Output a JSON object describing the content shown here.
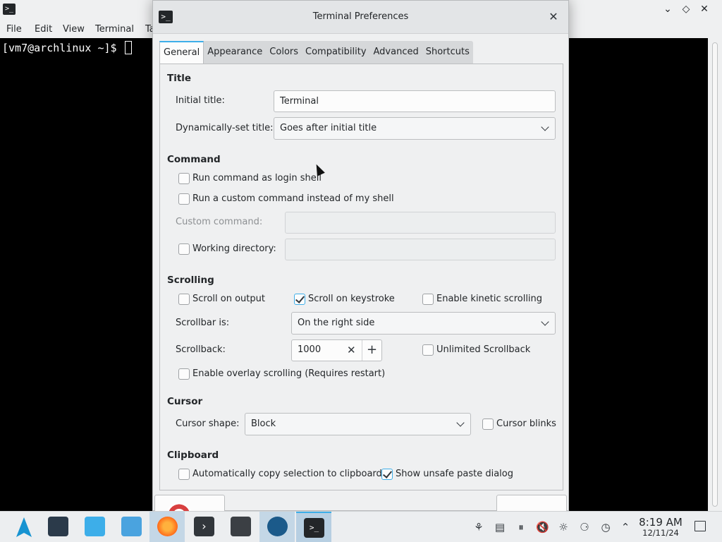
{
  "background_window": {
    "menu": [
      "File",
      "Edit",
      "View",
      "Terminal",
      "Ta"
    ],
    "prompt": "[vm7@archlinux ~]$ "
  },
  "dialog": {
    "title": "Terminal Preferences",
    "tabs": [
      "General",
      "Appearance",
      "Colors",
      "Compatibility",
      "Advanced",
      "Shortcuts"
    ],
    "active_tab": "General",
    "title_section": {
      "heading": "Title",
      "initial_title_label": "Initial title:",
      "initial_title_value": "Terminal",
      "dynamic_label": "Dynamically-set title:",
      "dynamic_value": "Goes after initial title"
    },
    "command_section": {
      "heading": "Command",
      "login_shell": "Run command as login shell",
      "login_shell_checked": false,
      "custom_command": "Run a custom command instead of my shell",
      "custom_command_checked": false,
      "custom_command_label": "Custom command:",
      "custom_command_value": "",
      "working_dir": "Working directory:",
      "working_dir_checked": false,
      "working_dir_value": ""
    },
    "scrolling_section": {
      "heading": "Scrolling",
      "scroll_output": "Scroll on output",
      "scroll_output_checked": false,
      "scroll_keystroke": "Scroll on keystroke",
      "scroll_keystroke_checked": true,
      "kinetic": "Enable kinetic scrolling",
      "kinetic_checked": false,
      "scrollbar_label": "Scrollbar is:",
      "scrollbar_value": "On the right side",
      "scrollback_label": "Scrollback:",
      "scrollback_value": "1000",
      "unlimited": "Unlimited Scrollback",
      "unlimited_checked": false,
      "overlay": "Enable overlay scrolling (Requires restart)",
      "overlay_checked": false
    },
    "cursor_section": {
      "heading": "Cursor",
      "shape_label": "Cursor shape:",
      "shape_value": "Block",
      "blinks": "Cursor blinks",
      "blinks_checked": false
    },
    "clipboard_section": {
      "heading": "Clipboard",
      "auto_copy": "Automatically copy selection to clipboard",
      "auto_copy_checked": false,
      "unsafe_paste": "Show unsafe paste dialog",
      "unsafe_paste_checked": true
    }
  },
  "taskbar": {
    "apps": [
      "arch-launcher-icon",
      "system-settings-icon",
      "discover-store-icon",
      "file-manager-icon",
      "firefox-icon",
      "terminal-launcher-icon",
      "audio-app-icon",
      "steam-icon",
      "terminal-window-icon"
    ],
    "tray": [
      "network-share-icon",
      "clipboard-icon",
      "media-pause-icon",
      "volume-muted-icon",
      "brightness-icon",
      "vpn-globe-icon",
      "update-icon",
      "tray-expand-icon"
    ],
    "time": "8:19 AM",
    "date": "12/11/24"
  },
  "colors": {
    "accent": "#3daee9",
    "terminal_bg": "#000000",
    "window_bg": "#eff0f1"
  }
}
